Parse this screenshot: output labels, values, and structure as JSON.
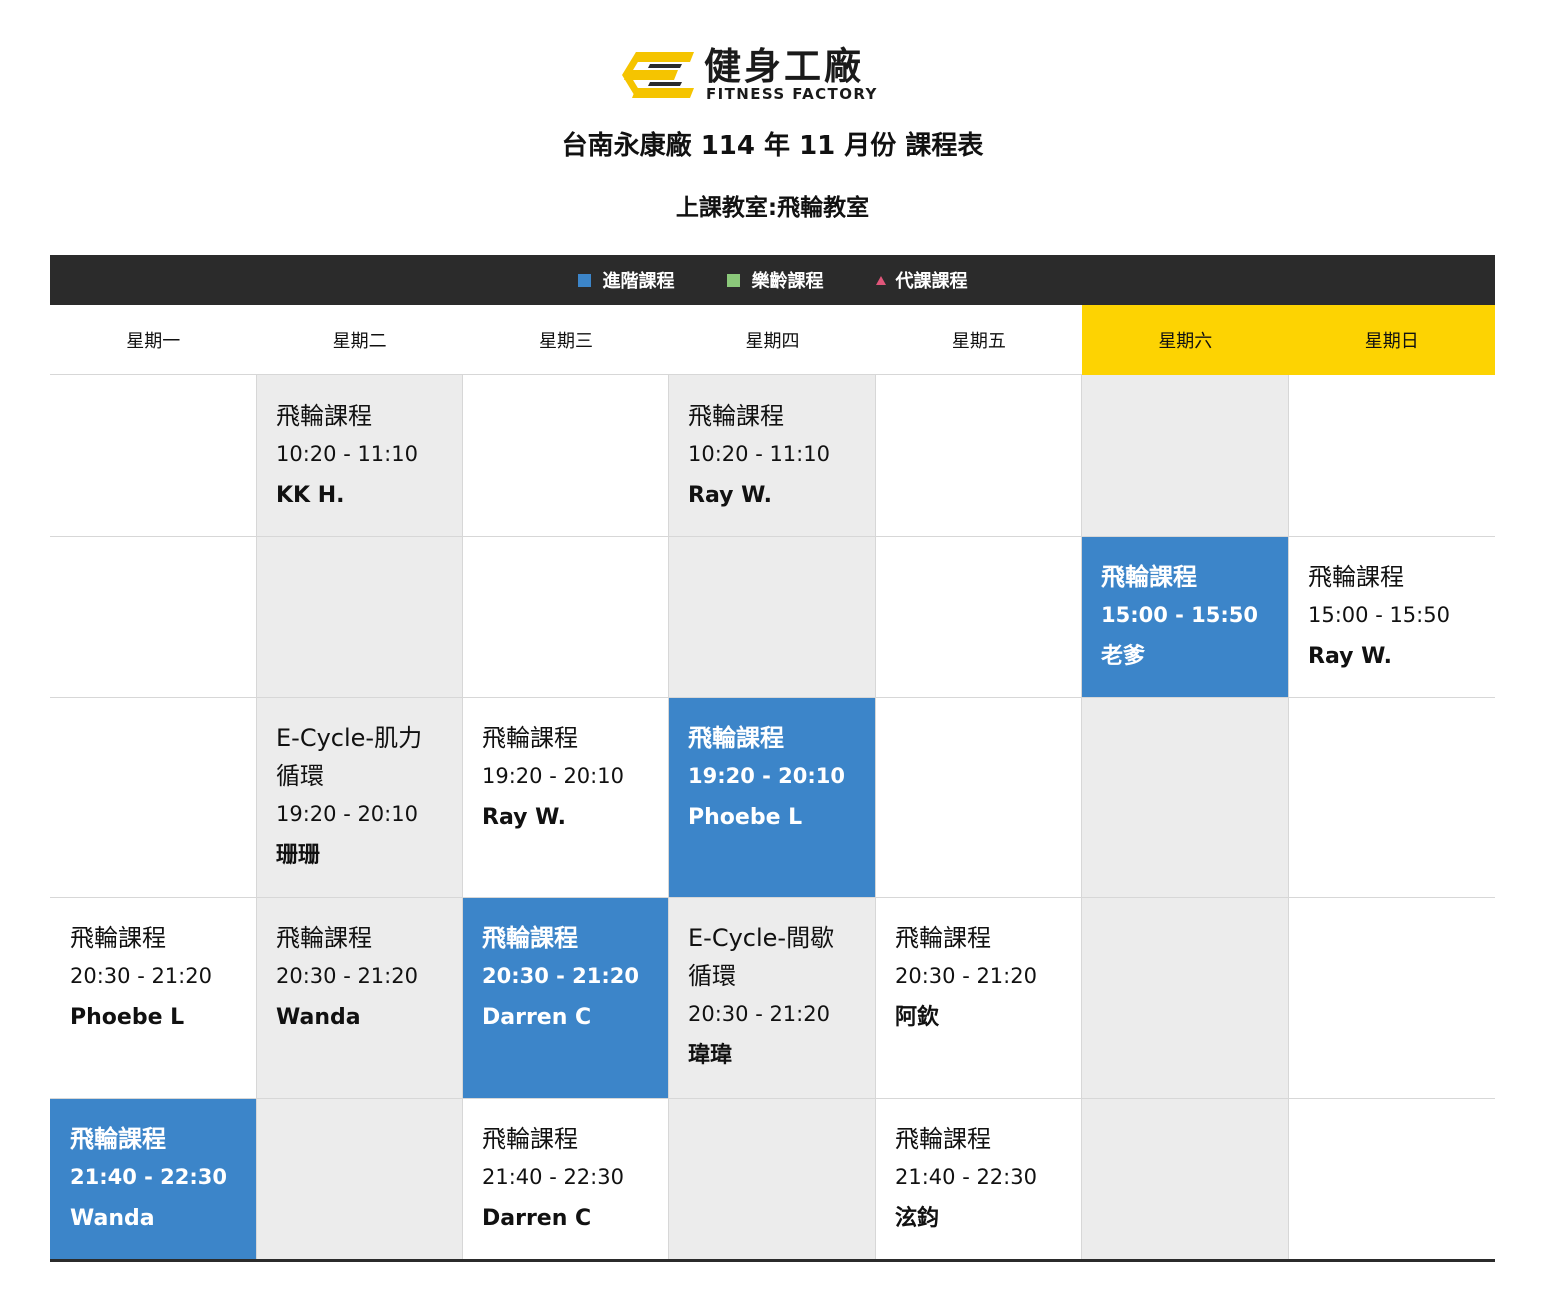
{
  "brand": {
    "name_cn": "健身工廠",
    "name_en": "FITNESS FACTORY",
    "colors": {
      "yellow": "#fdd302",
      "dark": "#2b2b2b"
    }
  },
  "header": {
    "title": "台南永康廠 114 年 11 月份 課程表",
    "room": "上課教室:飛輪教室"
  },
  "legend": [
    {
      "label": "進階課程",
      "marker": "square",
      "color": "#3c85c9"
    },
    {
      "label": "樂齡課程",
      "marker": "square",
      "color": "#8bc87a"
    },
    {
      "label": "代課課程",
      "marker": "triangle",
      "color": "#e0567a"
    }
  ],
  "days": [
    "星期一",
    "星期二",
    "星期三",
    "星期四",
    "星期五",
    "星期六",
    "星期日"
  ],
  "colors": {
    "advanced": "#3c85c9",
    "gray": "#ececec",
    "weekend": "#fdd302"
  },
  "sessions": [
    {
      "day": 1,
      "slot": 0,
      "name": "飛輪課程",
      "time": "10:20 - 11:10",
      "instructor": "KK H.",
      "type": "normal"
    },
    {
      "day": 3,
      "slot": 0,
      "name": "飛輪課程",
      "time": "10:20 - 11:10",
      "instructor": "Ray W.",
      "type": "normal"
    },
    {
      "day": 5,
      "slot": 1,
      "name": "飛輪課程",
      "time": "15:00 - 15:50",
      "instructor": "老爹",
      "type": "advanced"
    },
    {
      "day": 6,
      "slot": 1,
      "name": "飛輪課程",
      "time": "15:00 - 15:50",
      "instructor": "Ray W.",
      "type": "normal"
    },
    {
      "day": 1,
      "slot": 2,
      "name": "E-Cycle-肌力循環",
      "time": "19:20 - 20:10",
      "instructor": "珊珊",
      "type": "normal"
    },
    {
      "day": 2,
      "slot": 2,
      "name": "飛輪課程",
      "time": "19:20 - 20:10",
      "instructor": "Ray W.",
      "type": "normal"
    },
    {
      "day": 3,
      "slot": 2,
      "name": "飛輪課程",
      "time": "19:20 - 20:10",
      "instructor": "Phoebe L",
      "type": "advanced"
    },
    {
      "day": 0,
      "slot": 3,
      "name": "飛輪課程",
      "time": "20:30 - 21:20",
      "instructor": "Phoebe L",
      "type": "normal"
    },
    {
      "day": 1,
      "slot": 3,
      "name": "飛輪課程",
      "time": "20:30 - 21:20",
      "instructor": "Wanda",
      "type": "normal"
    },
    {
      "day": 2,
      "slot": 3,
      "name": "飛輪課程",
      "time": "20:30 - 21:20",
      "instructor": "Darren C",
      "type": "advanced"
    },
    {
      "day": 3,
      "slot": 3,
      "name": "E-Cycle-間歇循環",
      "time": "20:30 - 21:20",
      "instructor": "瑋瑋",
      "type": "normal"
    },
    {
      "day": 4,
      "slot": 3,
      "name": "飛輪課程",
      "time": "20:30 - 21:20",
      "instructor": "阿欽",
      "type": "normal"
    },
    {
      "day": 0,
      "slot": 4,
      "name": "飛輪課程",
      "time": "21:40 - 22:30",
      "instructor": "Wanda",
      "type": "advanced"
    },
    {
      "day": 2,
      "slot": 4,
      "name": "飛輪課程",
      "time": "21:40 - 22:30",
      "instructor": "Darren C",
      "type": "normal"
    },
    {
      "day": 4,
      "slot": 4,
      "name": "飛輪課程",
      "time": "21:40 - 22:30",
      "instructor": "泫鈞",
      "type": "normal"
    }
  ]
}
